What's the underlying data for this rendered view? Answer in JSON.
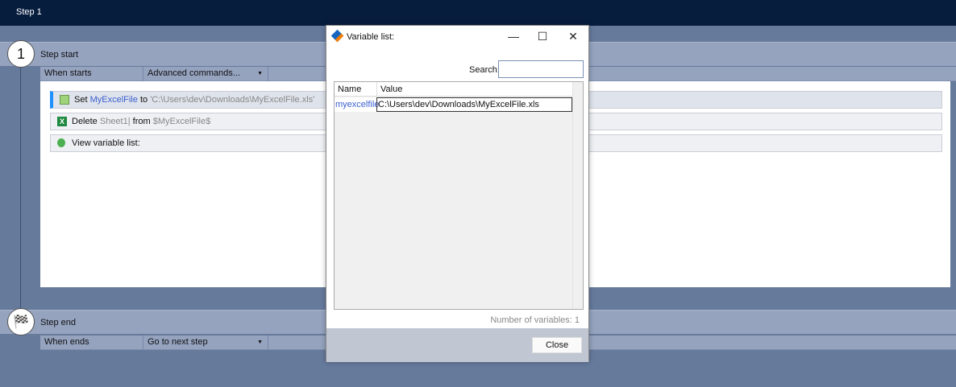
{
  "window": {
    "title": "Step 1"
  },
  "step_start": {
    "number": "1",
    "label": "Step start",
    "trigger_label": "When starts",
    "trigger_value": "Advanced commands..."
  },
  "commands": [
    {
      "verb": "Set",
      "var": "MyExcelFile",
      "mid": "to",
      "value": "'C:\\Users\\dev\\Downloads\\MyExcelFile.xls'",
      "icon": "set-variable-icon"
    },
    {
      "verb": "Delete",
      "var": "Sheet1|",
      "mid": "from",
      "value": "$MyExcelFile$",
      "icon": "excel-icon"
    },
    {
      "verb": "View variable list:",
      "icon": "bug-icon"
    }
  ],
  "step_end": {
    "label": "Step end",
    "trigger_label": "When ends",
    "trigger_value": "Go to next step"
  },
  "dialog": {
    "title": "Variable list:",
    "search_label": "Search:",
    "search_value": "",
    "columns": [
      "Name",
      "Value"
    ],
    "rows": [
      {
        "name": "myexcelfile",
        "value": "C:\\Users\\dev\\Downloads\\MyExcelFile.xls"
      }
    ],
    "count_text": "Number of variables: 1",
    "close_label": "Close"
  }
}
